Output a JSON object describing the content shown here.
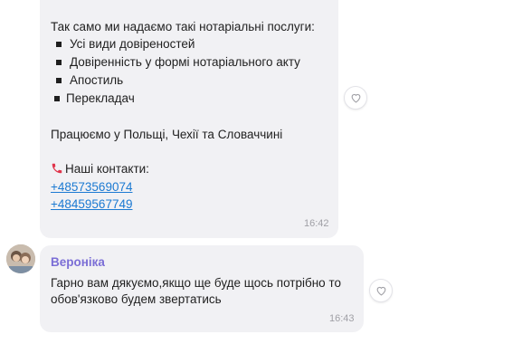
{
  "message1": {
    "intro": "Так само ми надаємо такі нотаріальні послуги:",
    "items": [
      "Усі види довіреностей",
      "Довіренність у формі нотаріального акту",
      "Апостиль",
      "Перекладач"
    ],
    "countries": "Працюємо у Польщі, Чехії та Словаччині",
    "contacts_label": "Наші контакти:",
    "phones": [
      "+48573569074",
      "+48459567749"
    ],
    "time": "16:42",
    "icons": {
      "contacts": "telephone-receiver-icon",
      "reaction": "heart-icon"
    }
  },
  "message2": {
    "sender": "Вероніка",
    "text_line1": "Гарно вам дякуємо,якщо ще буде щось потрібно то",
    "text_line2": "обов'язково будем звертатись",
    "time": "16:43",
    "icons": {
      "reaction": "heart-icon"
    }
  },
  "colors": {
    "bubble": "#f1f1f4",
    "link": "#1c7ad2",
    "sender": "#7b6ed6",
    "timestamp": "#a0a0a6"
  }
}
